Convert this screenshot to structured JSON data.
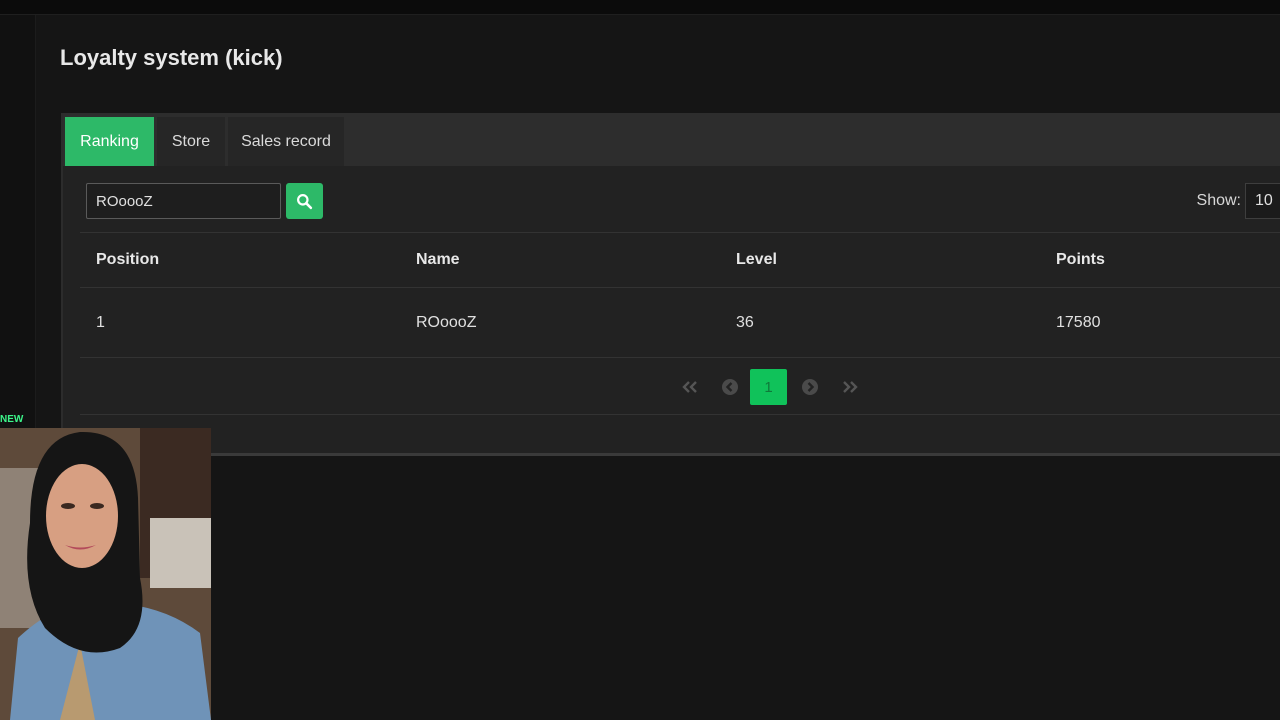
{
  "page": {
    "title": "Loyalty system (kick)"
  },
  "tabs": [
    {
      "label": "Ranking",
      "active": true
    },
    {
      "label": "Store",
      "active": false
    },
    {
      "label": "Sales record",
      "active": false
    }
  ],
  "search": {
    "value": "ROoooZ",
    "icon": "search-icon"
  },
  "show": {
    "label": "Show:",
    "value": "10"
  },
  "table": {
    "headers": [
      "Position",
      "Name",
      "Level",
      "Points"
    ],
    "rows": [
      [
        "1",
        "ROoooZ",
        "36",
        "17580"
      ]
    ]
  },
  "pagination": {
    "current": "1",
    "icons": [
      "first-page-icon",
      "prev-page-icon",
      "next-page-icon",
      "last-page-icon"
    ]
  },
  "overlay": {
    "badge": "NEW"
  },
  "colors": {
    "accent": "#2db968",
    "current_page": "#10c25a",
    "background": "#151515",
    "panel": "#222222"
  }
}
